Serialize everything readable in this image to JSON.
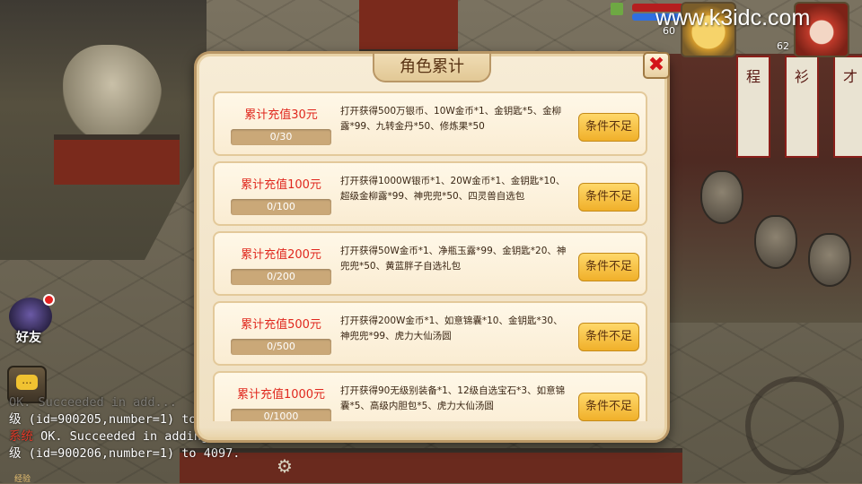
{
  "hud": {
    "watermark": "www.k3idc.com",
    "pet_level": "60",
    "hero_level": "62",
    "friends_label": "好友",
    "chat_icon": "...",
    "gear_icon_glyph": "⚙",
    "exp_label": "经验"
  },
  "camp_flags": [
    "程",
    "衫",
    "才"
  ],
  "chat_log": [
    {
      "tag": "",
      "text": "OK. Succeeded in add..."
    },
    {
      "tag": "",
      "text": "级 (id=900205,number=1) to"
    },
    {
      "tag": "系统",
      "text": " OK. Succeeded in adding 安华印"
    },
    {
      "tag": "",
      "text": "级 (id=900206,number=1) to 4097."
    }
  ],
  "modal": {
    "title": "角色累计",
    "close_icon": "✖",
    "rows": [
      {
        "tier": "累计充值30元",
        "progress_text": "0/30",
        "progress_fraction": 0,
        "reward": "打开获得500万银币、10W金币*1、金钥匙*5、金柳露*99、九转金丹*50、修炼果*50",
        "button": "条件不足"
      },
      {
        "tier": "累计充值100元",
        "progress_text": "0/100",
        "progress_fraction": 0,
        "reward": "打开获得1000W银币*1、20W金币*1、金钥匙*10、超级金柳露*99、神兜兜*50、四灵兽自选包",
        "button": "条件不足"
      },
      {
        "tier": "累计充值200元",
        "progress_text": "0/200",
        "progress_fraction": 0,
        "reward": "打开获得50W金币*1、净瓶玉露*99、金钥匙*20、神兜兜*50、黄蓝胖子自选礼包",
        "button": "条件不足"
      },
      {
        "tier": "累计充值500元",
        "progress_text": "0/500",
        "progress_fraction": 0,
        "reward": "打开获得200W金币*1、如意锦囊*10、金钥匙*30、神兜兜*99、虎力大仙汤圆",
        "button": "条件不足"
      },
      {
        "tier": "累计充值1000元",
        "progress_text": "0/1000",
        "progress_fraction": 0,
        "reward": "打开获得90无级别装备*1、12级自选宝石*3、如意锦囊*5、高级内胆包*5、虎力大仙汤圆",
        "button": "条件不足"
      }
    ]
  },
  "colors": {
    "tier_text": "#e0281e",
    "button_bg": "#f0b02a",
    "modal_bg": "#f7ecd6",
    "close_x": "#d3141a"
  }
}
